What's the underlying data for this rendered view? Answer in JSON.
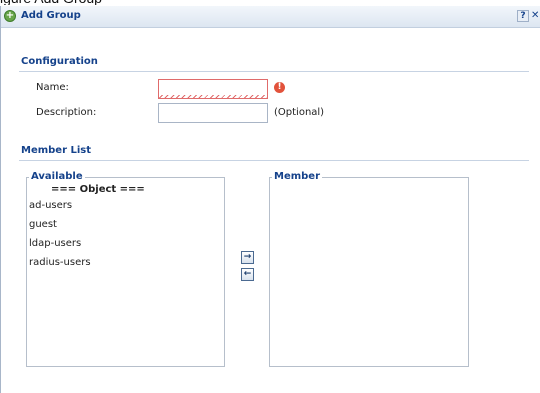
{
  "dialog": {
    "title": "Add Group",
    "help_label": "?",
    "close_label": "✕"
  },
  "configuration": {
    "title": "Configuration",
    "name_label": "Name:",
    "name_value": "",
    "name_error_mark": "!",
    "description_label": "Description:",
    "description_value": "",
    "optional_note": "(Optional)"
  },
  "member_list": {
    "title": "Member List",
    "available": {
      "legend": "Available",
      "header": "=== Object ===",
      "items": [
        "ad-users",
        "guest",
        "ldap-users",
        "radius-users"
      ]
    },
    "member": {
      "legend": "Member",
      "items": []
    },
    "add_button": "→",
    "remove_button": "←"
  },
  "colors": {
    "accent": "#15428b",
    "error": "#e2523b"
  }
}
